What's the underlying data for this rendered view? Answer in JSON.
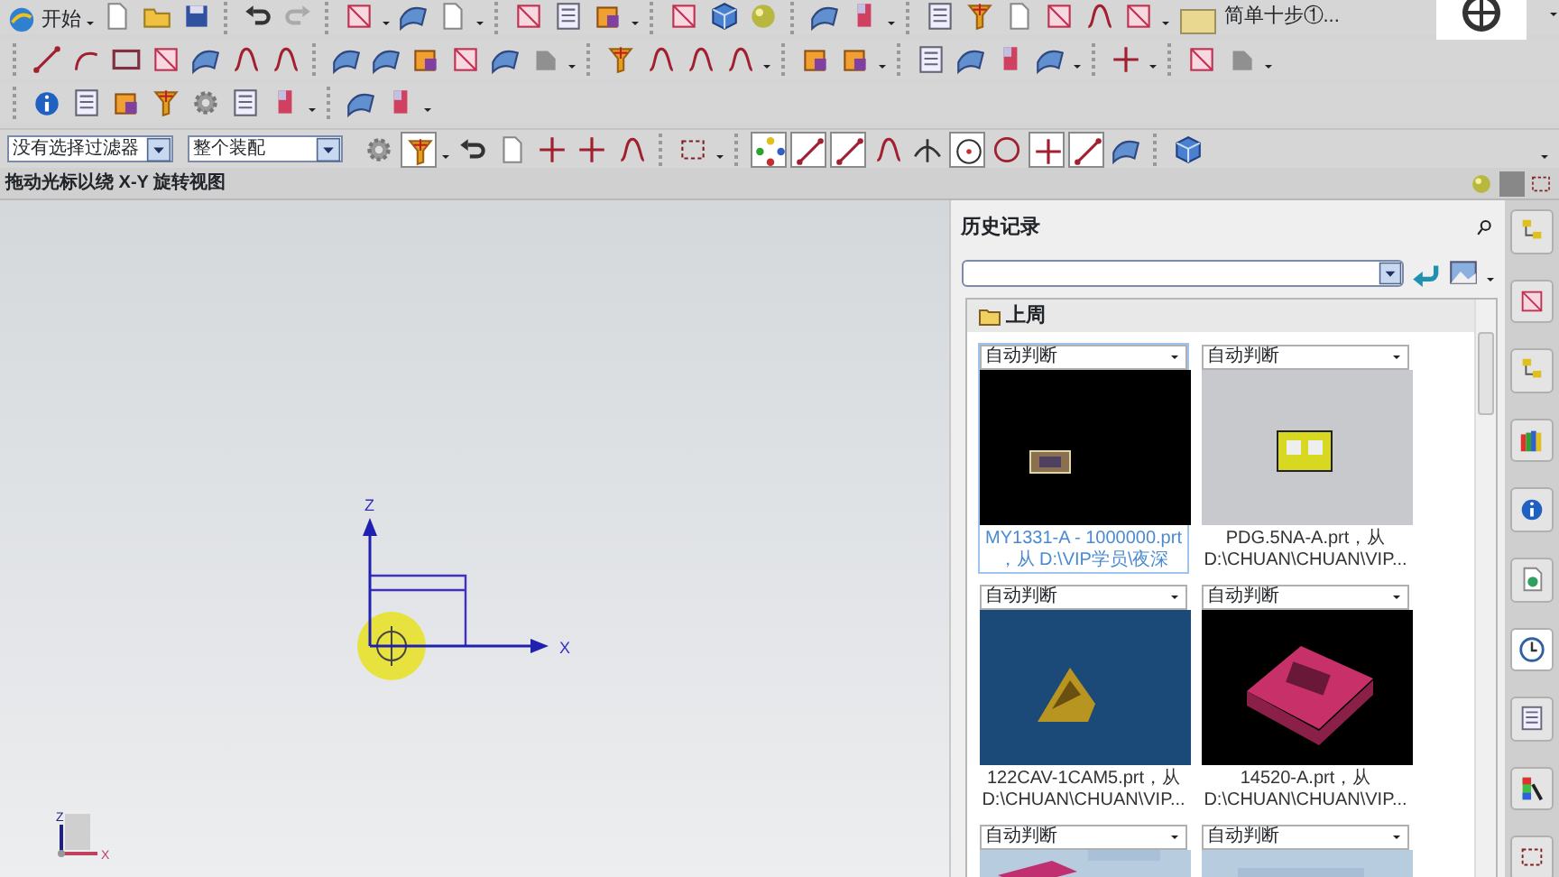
{
  "toolbar": {
    "start_label": "开始",
    "quick_tip": "简单十步①..."
  },
  "selection_bar": {
    "filter": "没有选择过滤器",
    "scope": "整个装配",
    "filter_button_on": true,
    "snap_buttons": [
      {
        "on": true
      },
      {
        "on": true
      },
      {
        "on": true
      },
      {
        "on": false
      },
      {
        "on": false
      },
      {
        "on": true
      },
      {
        "on": false
      },
      {
        "on": true
      },
      {
        "on": true
      },
      {
        "on": false
      },
      {
        "on": false
      }
    ]
  },
  "cue_line": "拖动光标以绕 X-Y 旋转视图",
  "viewport": {
    "axis_z": "Z",
    "axis_x": "X",
    "triad_z": "Z",
    "triad_x": "X"
  },
  "history": {
    "title": "历史记录",
    "group": "上周",
    "items": [
      {
        "mode": "自动判断",
        "kind": "picture",
        "selected": true,
        "caption": [
          "MY1331-A - 1000000.prt",
          "，从 D:\\VIP学员\\夜深"
        ]
      },
      {
        "mode": "自动判断",
        "kind": "picture",
        "selected": false,
        "caption": [
          "PDG.5NA-A.prt，从",
          "D:\\CHUAN\\CHUAN\\VIP..."
        ]
      },
      {
        "mode": "自动判断",
        "kind": "picture",
        "selected": false,
        "caption": [
          "122CAV-1CAM5.prt，从",
          "D:\\CHUAN\\CHUAN\\VIP..."
        ]
      },
      {
        "mode": "自动判断",
        "kind": "picture",
        "selected": false,
        "caption": [
          "14520-A.prt，从",
          "D:\\CHUAN\\CHUAN\\VIP..."
        ]
      },
      {
        "mode": "自动判断",
        "kind": "picture",
        "selected": false
      },
      {
        "mode": "自动判断",
        "kind": "picture",
        "selected": false
      }
    ]
  },
  "resource_tabs": [
    {
      "selected": false
    },
    {
      "selected": false
    },
    {
      "selected": false
    },
    {
      "selected": false
    },
    {
      "selected": false
    },
    {
      "selected": false
    },
    {
      "selected": true
    },
    {
      "selected": false
    },
    {
      "selected": false
    },
    {
      "selected": false
    }
  ]
}
